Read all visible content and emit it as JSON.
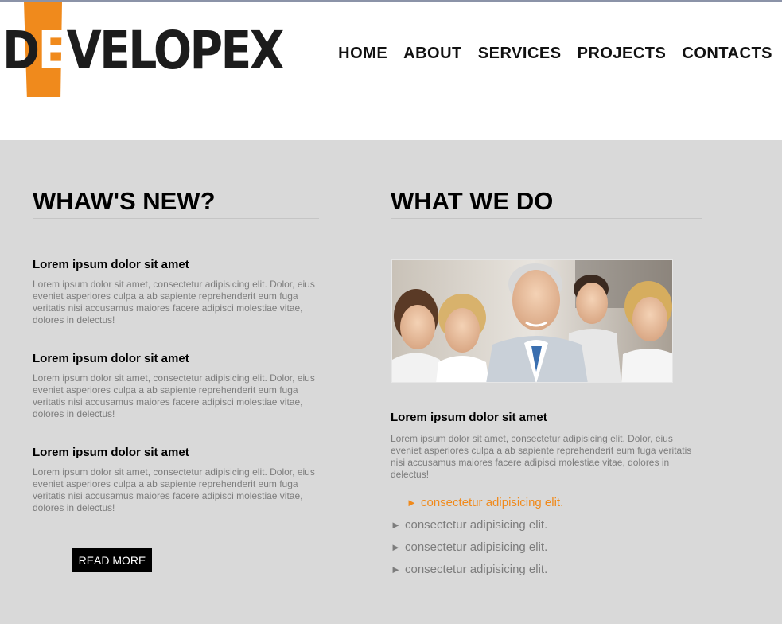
{
  "header": {
    "logo_text_1": "D",
    "logo_text_2": "E",
    "logo_text_3": "VELOPEX",
    "nav": [
      "HOME",
      "ABOUT",
      "SERVICES",
      "PROJECTS",
      "CONTACTS"
    ],
    "accent_color": "#f08a1c"
  },
  "news": {
    "title": "WHAW'S NEW?",
    "items": [
      {
        "heading": "Lorem ipsum dolor sit amet",
        "text": "Lorem ipsum dolor sit amet, consectetur adipisicing elit. Dolor, eius eveniet asperiores culpa a ab sapiente reprehenderit eum fuga veritatis nisi accusamus maiores facere adipisci molestiae vitae, dolores in delectus!"
      },
      {
        "heading": "Lorem ipsum dolor sit amet",
        "text": "Lorem ipsum dolor sit amet, consectetur adipisicing elit. Dolor, eius eveniet asperiores culpa a ab sapiente reprehenderit eum fuga veritatis nisi accusamus maiores facere adipisci molestiae vitae, dolores in delectus!"
      },
      {
        "heading": "Lorem ipsum dolor sit amet",
        "text": "Lorem ipsum dolor sit amet, consectetur adipisicing elit. Dolor, eius eveniet asperiores culpa a ab sapiente reprehenderit eum fuga veritatis nisi accusamus maiores facere adipisci molestiae vitae, dolores in delectus!"
      }
    ],
    "read_more": "READ MORE"
  },
  "whatwedo": {
    "title": "WHAT WE DO",
    "heading": "Lorem ipsum dolor sit amet",
    "text": "Lorem ipsum dolor sit amet, consectetur adipisicing elit. Dolor, eius eveniet asperiores culpa a ab sapiente reprehenderit eum fuga veritatis nisi accusamus maiores facere adipisci molestiae vitae, dolores in delectus!",
    "list": [
      "consectetur adipisicing elit.",
      "consectetur adipisicing elit.",
      "consectetur adipisicing elit.",
      "consectetur adipisicing elit."
    ],
    "arrow_glyph": "►"
  }
}
